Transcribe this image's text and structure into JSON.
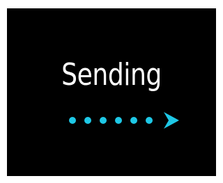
{
  "status": {
    "title": "Sending"
  },
  "progress_indicator": {
    "dot_count": 6,
    "arrow_icon": "chevron-right-icon",
    "accent_color": "#1ec8e6"
  },
  "colors": {
    "background": "#000000",
    "text": "#ffffff"
  }
}
